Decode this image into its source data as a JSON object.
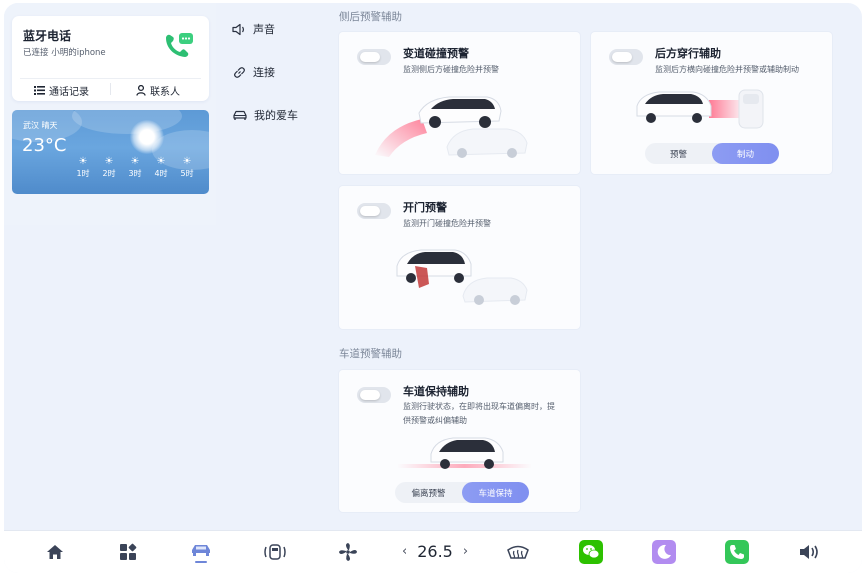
{
  "bluetooth": {
    "title": "蓝牙电话",
    "status": "已连接 小明的iphone",
    "call_log": "通话记录",
    "contacts": "联系人"
  },
  "weather": {
    "location": "武汉 晴天",
    "temperature": "23°C",
    "forecast": [
      {
        "label": "1时",
        "icon": "sun-icon"
      },
      {
        "label": "2时",
        "icon": "sun-icon"
      },
      {
        "label": "3时",
        "icon": "sun-icon"
      },
      {
        "label": "4时",
        "icon": "sun-icon"
      },
      {
        "label": "5时",
        "icon": "sun-icon"
      }
    ]
  },
  "menu": {
    "items": [
      {
        "label": "声音",
        "icon": "speaker-icon"
      },
      {
        "label": "连接",
        "icon": "link-icon"
      },
      {
        "label": "我的爱车",
        "icon": "car-icon"
      }
    ]
  },
  "sections": {
    "rear_side": "侧后预警辅助",
    "lane": "车道预警辅助"
  },
  "cards": {
    "lane_change": {
      "title": "变道碰撞预警",
      "desc": "监测侧后方碰撞危险并预警"
    },
    "rear_cross": {
      "title": "后方穿行辅助",
      "desc": "监测后方横向碰撞危险并预警或辅助制动",
      "options": [
        "预警",
        "制动"
      ],
      "selected": "制动"
    },
    "door_open": {
      "title": "开门预警",
      "desc": "监测开门碰撞危险并预警"
    },
    "lane_keep": {
      "title": "车道保持辅助",
      "desc_line1": "监测行驶状态，在即将出现车道偏离时，提",
      "desc_line2": "供预警或纠偏辅助",
      "options": [
        "偏离预警",
        "车道保持"
      ],
      "selected": "车道保持"
    }
  },
  "dock": {
    "temperature": "26.5",
    "items": [
      "home-icon",
      "apps-icon",
      "car-icon",
      "vehicle-control-icon",
      "fan-icon",
      "defrost-icon",
      "wechat-icon",
      "moon-icon",
      "phone-icon",
      "volume-icon"
    ],
    "colors": {
      "accent": "#7f8ff0",
      "wechat": "#2dc100",
      "moon": "#b28cf0",
      "phone": "#34c759"
    }
  }
}
